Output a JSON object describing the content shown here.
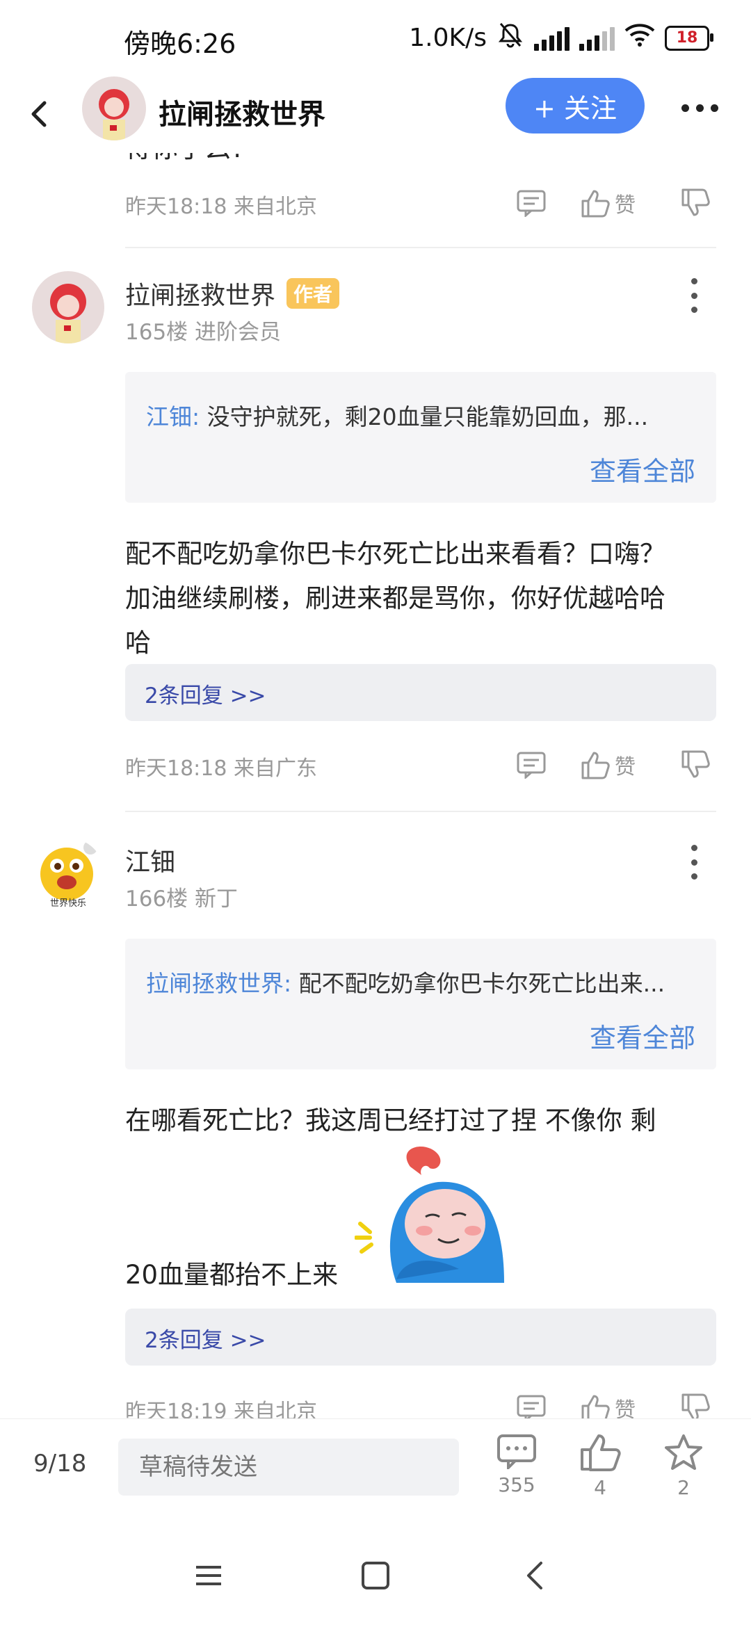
{
  "status_bar": {
    "time": "傍晚6:26",
    "net_speed": "1.0K/s",
    "battery": "18"
  },
  "header": {
    "back_icon": "chevron-left-icon",
    "username": "拉闸拯救世界",
    "follow_label": "+ 关注",
    "more_icon": "more-horizontal-icon"
  },
  "feed": {
    "cut_text": "得你了么?",
    "prev_meta": {
      "time": "昨天18:18 来自北京",
      "like_label": "赞"
    },
    "comments": [
      {
        "name": "拉闸拯救世界",
        "badge": "作者",
        "floor_info": "165楼 进阶会员",
        "quote": {
          "name": "江钿:",
          "text": " 没守护就死，剩20血量只能靠奶回血，那...",
          "more": "查看全部"
        },
        "body_lines": [
          "配不配吃奶拿你巴卡尔死亡比出来看看？口嗨？",
          "加油继续刷楼，刷进来都是骂你，你好优越哈哈",
          "哈"
        ],
        "replies": "2条回复 >>",
        "meta": {
          "time": "昨天18:18 来自广东",
          "like_label": "赞"
        }
      },
      {
        "name": "江钿",
        "floor_info": "166楼 新丁",
        "avatar_caption": "世界快乐",
        "quote": {
          "name": "拉闸拯救世界:",
          "text": " 配不配吃奶拿你巴卡尔死亡比出来...",
          "more": "查看全部"
        },
        "body_line1": "在哪看死亡比？我这周已经打过了捏 不像你 剩",
        "body_line2": "20血量都抬不上来",
        "replies": "2条回复 >>",
        "meta": {
          "time": "昨天18:19 来自北京",
          "like_label": "赞"
        }
      }
    ]
  },
  "bottom_bar": {
    "page": "9/18",
    "draft_placeholder": "草稿待发送",
    "comment_count": "355",
    "like_count": "4",
    "fav_count": "2"
  },
  "colors": {
    "accent": "#4e86f5",
    "link": "#4e86d8",
    "badge": "#f9c55b",
    "reply_link": "#3949a8"
  }
}
